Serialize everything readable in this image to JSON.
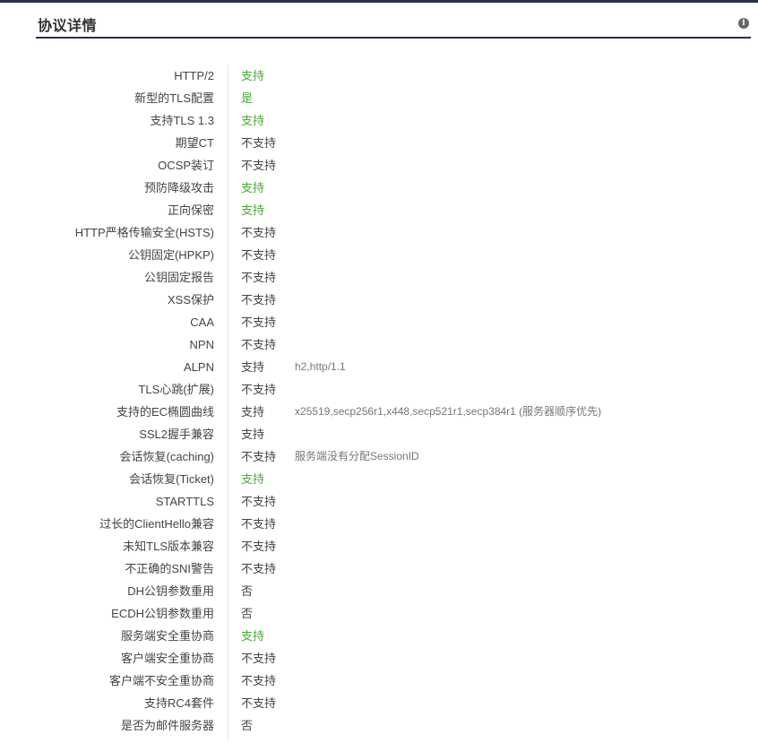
{
  "header": {
    "title": "协议详情",
    "info_icon": "info-icon"
  },
  "colors": {
    "accent_bar": "#2a2f4d",
    "positive": "#4aa839",
    "neutral": "#444444",
    "detail": "#777777"
  },
  "rows": [
    {
      "label": "HTTP/2",
      "value": "支持",
      "status": "ok",
      "detail": ""
    },
    {
      "label": "新型的TLS配置",
      "value": "是",
      "status": "ok",
      "detail": ""
    },
    {
      "label": "支持TLS 1.3",
      "value": "支持",
      "status": "ok",
      "detail": ""
    },
    {
      "label": "期望CT",
      "value": "不支持",
      "status": "neutral",
      "detail": ""
    },
    {
      "label": "OCSP装订",
      "value": "不支持",
      "status": "neutral",
      "detail": ""
    },
    {
      "label": "预防降级攻击",
      "value": "支持",
      "status": "ok",
      "detail": ""
    },
    {
      "label": "正向保密",
      "value": "支持",
      "status": "ok",
      "detail": ""
    },
    {
      "label": "HTTP严格传输安全(HSTS)",
      "value": "不支持",
      "status": "neutral",
      "detail": ""
    },
    {
      "label": "公钥固定(HPKP)",
      "value": "不支持",
      "status": "neutral",
      "detail": ""
    },
    {
      "label": "公钥固定报告",
      "value": "不支持",
      "status": "neutral",
      "detail": ""
    },
    {
      "label": "XSS保护",
      "value": "不支持",
      "status": "neutral",
      "detail": ""
    },
    {
      "label": "CAA",
      "value": "不支持",
      "status": "neutral",
      "detail": ""
    },
    {
      "label": "NPN",
      "value": "不支持",
      "status": "neutral",
      "detail": ""
    },
    {
      "label": "ALPN",
      "value": "支持",
      "status": "neutral",
      "detail": "h2,http/1.1"
    },
    {
      "label": "TLS心跳(扩展)",
      "value": "不支持",
      "status": "neutral",
      "detail": ""
    },
    {
      "label": "支持的EC椭圆曲线",
      "value": "支持",
      "status": "neutral",
      "detail": "x25519,secp256r1,x448,secp521r1,secp384r1 (服务器顺序优先)"
    },
    {
      "label": "SSL2握手兼容",
      "value": "支持",
      "status": "neutral",
      "detail": ""
    },
    {
      "label": "会话恢复(caching)",
      "value": "不支持",
      "status": "neutral",
      "detail": "服务端没有分配SessionID"
    },
    {
      "label": "会话恢复(Ticket)",
      "value": "支持",
      "status": "ok",
      "detail": ""
    },
    {
      "label": "STARTTLS",
      "value": "不支持",
      "status": "neutral",
      "detail": ""
    },
    {
      "label": "过长的ClientHello兼容",
      "value": "不支持",
      "status": "neutral",
      "detail": ""
    },
    {
      "label": "未知TLS版本兼容",
      "value": "不支持",
      "status": "neutral",
      "detail": ""
    },
    {
      "label": "不正确的SNI警告",
      "value": "不支持",
      "status": "neutral",
      "detail": ""
    },
    {
      "label": "DH公钥参数重用",
      "value": "否",
      "status": "neutral",
      "detail": ""
    },
    {
      "label": "ECDH公钥参数重用",
      "value": "否",
      "status": "neutral",
      "detail": ""
    },
    {
      "label": "服务端安全重协商",
      "value": "支持",
      "status": "ok",
      "detail": ""
    },
    {
      "label": "客户端安全重协商",
      "value": "不支持",
      "status": "neutral",
      "detail": ""
    },
    {
      "label": "客户端不安全重协商",
      "value": "不支持",
      "status": "neutral",
      "detail": ""
    },
    {
      "label": "支持RC4套件",
      "value": "不支持",
      "status": "neutral",
      "detail": ""
    },
    {
      "label": "是否为邮件服务器",
      "value": "否",
      "status": "neutral",
      "detail": ""
    }
  ]
}
